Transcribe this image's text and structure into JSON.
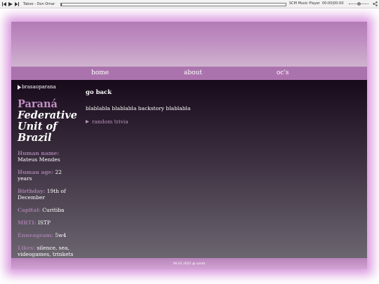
{
  "player": {
    "track": "Taboo - Don Omar",
    "player_name": "SCM Music Player",
    "time": "00:00|00:00",
    "progress_fraction": 0.0,
    "volume_fraction": 0.5
  },
  "nav": {
    "items": [
      "home",
      "about",
      "oc's"
    ]
  },
  "sidebar": {
    "image_alt": "brasaoparana",
    "region": "Paraná",
    "title": "Federative Unit of Brazil",
    "fields": [
      {
        "key": "Human name:",
        "value": "Mateus Mendes"
      },
      {
        "key": "Human age:",
        "value": "22 years"
      },
      {
        "key": "Birthday:",
        "value": "19th of December"
      },
      {
        "key": "Capital:",
        "value": "Curitiba"
      },
      {
        "key": "MBTI:",
        "value": "ISTP"
      },
      {
        "key": "Enneagram:",
        "value": "5w4"
      },
      {
        "key": "Likes:",
        "value": "silence, sea, videogames, trinkets"
      }
    ]
  },
  "main": {
    "go_back": "go back",
    "backstory": "blablabla blablabla backstory blablabla",
    "trivia": "random trivia"
  },
  "footer": {
    "text": "06.02.2025 @ sarah"
  },
  "colors": {
    "glow": "#ce78d4",
    "nav": "#ab73ad",
    "accent_text": "#c28ec6",
    "label_text": "#a07ba6"
  }
}
